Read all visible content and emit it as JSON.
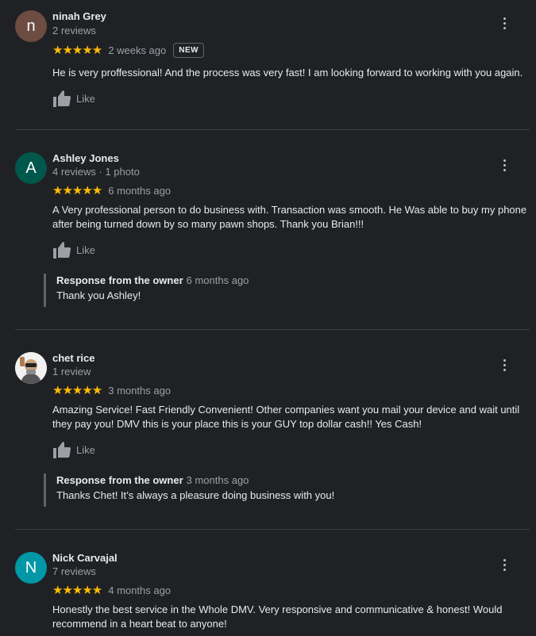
{
  "reviews": [
    {
      "avatar_letter": "n",
      "avatar_color": "#6d4c41",
      "name": "ninah Grey",
      "meta": "2 reviews",
      "stars": "★★★★★",
      "when": "2 weeks ago",
      "badge": "NEW",
      "text": "He is very proffessional! And the process was very fast! I am looking forward to working with you again.",
      "like_label": "Like"
    },
    {
      "avatar_letter": "A",
      "avatar_color": "#00574b",
      "name": "Ashley Jones",
      "meta": "4 reviews · 1 photo",
      "stars": "★★★★★",
      "when": "6 months ago",
      "text": "A Very professional person to do business with. Transaction was smooth. He Was able to buy my phone after being turned down by so many pawn shops. Thank you Brian!!!",
      "like_label": "Like",
      "response": {
        "label": "Response from the owner",
        "when": "6 months ago",
        "text": "Thank you Ashley!"
      }
    },
    {
      "avatar_letter": "",
      "avatar_color": "#ffffff",
      "name": "chet rice",
      "meta": "1 review",
      "stars": "★★★★★",
      "when": "3 months ago",
      "text": "Amazing Service! Fast Friendly Convenient! Other companies want you mail your device and wait until they pay you! DMV this is your place this is your GUY top dollar cash!! Yes Cash!",
      "like_label": "Like",
      "response": {
        "label": "Response from the owner",
        "when": "3 months ago",
        "text": "Thanks Chet! It’s always a pleasure doing business with you!"
      }
    },
    {
      "avatar_letter": "N",
      "avatar_color": "#0097a7",
      "name": "Nick Carvajal",
      "meta": "7 reviews",
      "stars": "★★★★★",
      "when": "4 months ago",
      "text": "Honestly the best service in the Whole DMV. Very responsive and communicative & honest! Would recommend in a heart beat to anyone!"
    }
  ],
  "icons": {
    "like": "thumbs-up-icon",
    "menu": "more-vert-icon"
  }
}
